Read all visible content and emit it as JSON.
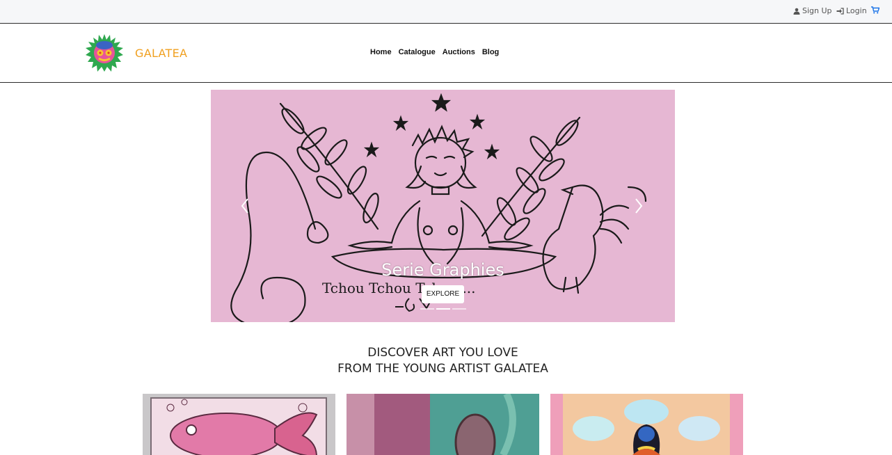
{
  "topbar": {
    "signup_label": "Sign Up",
    "login_label": "Login",
    "icons": [
      "user-icon",
      "sign-in-icon",
      "cart-icon"
    ],
    "icon_color": "#1a73e8"
  },
  "header": {
    "brand": "GALATEA",
    "brand_color": "#f0a020",
    "nav": [
      "Home",
      "Catalogue",
      "Auctions",
      "Blog"
    ]
  },
  "carousel": {
    "caption": "Serie Graphies",
    "button_label": "EXPLORE",
    "slide_count": 3,
    "active_slide": 1,
    "artwork_text": "Tchou Tchou Tchou ..."
  },
  "headline": {
    "line1": "DISCOVER ART YOU LOVE",
    "line2": "FROM THE YOUNG ARTIST GALATEA"
  },
  "cards": [
    {
      "name": "fish-artwork"
    },
    {
      "name": "mirror-artwork"
    },
    {
      "name": "meditation-artwork"
    }
  ]
}
